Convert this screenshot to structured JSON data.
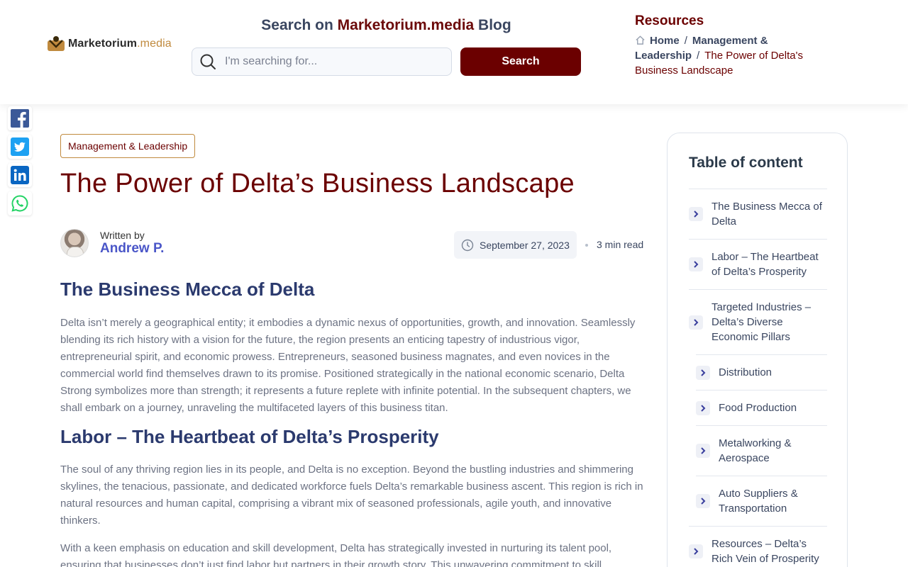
{
  "brand": {
    "name_bold": "Marketorium",
    "name_light": ".media"
  },
  "search": {
    "title_prefix": "Search on ",
    "title_brand": "Marketorium.media",
    "title_suffix": " Blog",
    "placeholder": "I'm searching for...",
    "value": "",
    "button_label": "Search"
  },
  "resources": {
    "title": "Resources",
    "breadcrumb": [
      {
        "label": "Home"
      },
      {
        "label": "Management & Leadership"
      },
      {
        "label": "The Power of Delta's Business Landscape"
      }
    ]
  },
  "social": [
    {
      "name": "facebook-icon",
      "color": "#3b5998"
    },
    {
      "name": "twitter-icon",
      "color": "#1da1f2"
    },
    {
      "name": "linkedin-icon",
      "color": "#0a66c2"
    },
    {
      "name": "whatsapp-icon",
      "color": "#25d366"
    }
  ],
  "article": {
    "category": "Management & Leadership",
    "title": "The Power of Delta’s Business Landscape",
    "author_label": "Written by",
    "author_name": "Andrew P.",
    "date": "September 27, 2023",
    "read_time": "3 min read",
    "sections": [
      {
        "heading": "The Business Mecca of Delta",
        "paragraphs": [
          "Delta isn’t merely a geographical entity; it embodies a dynamic nexus of opportunities, growth, and innovation. Seamlessly blending its rich history with a vision for the future, the region presents an enticing tapestry of industrious vigor, entrepreneurial spirit, and economic prowess. Entrepreneurs, seasoned business magnates, and even novices in the commercial world find themselves drawn to its promise. Positioned strategically in the national economic scenario, Delta Strong symbolizes more than strength; it represents a future replete with infinite potential. In the subsequent chapters, we shall embark on a journey, unraveling the multifaceted layers of this business titan."
        ]
      },
      {
        "heading": "Labor – The Heartbeat of Delta’s Prosperity",
        "paragraphs": [
          "The soul of any thriving region lies in its people, and Delta is no exception. Beyond the bustling industries and shimmering skylines, the tenacious, passionate, and dedicated workforce fuels Delta’s remarkable business ascent. This region is rich in natural resources and human capital, comprising a vibrant mix of seasoned professionals, agile youth, and innovative thinkers.",
          "With a keen emphasis on education and skill development, Delta has strategically invested in nurturing its talent pool, ensuring that businesses don’t just find labor but partners in their growth story. This unwavering commitment to skill"
        ]
      }
    ]
  },
  "toc": {
    "title": "Table of content",
    "items": [
      {
        "label": "The Business Mecca of Delta",
        "sub": false
      },
      {
        "label": "Labor – The Heartbeat of Delta’s Prosperity",
        "sub": false
      },
      {
        "label": "Targeted Industries – Delta’s Diverse Economic Pillars",
        "sub": false
      },
      {
        "label": "Distribution",
        "sub": true
      },
      {
        "label": "Food Production",
        "sub": true
      },
      {
        "label": "Metalworking & Aerospace",
        "sub": true
      },
      {
        "label": "Auto Suppliers & Transportation",
        "sub": true
      },
      {
        "label": "Resources – Delta’s Rich Vein of Prosperity",
        "sub": false
      }
    ]
  },
  "colors": {
    "brand_dark_red": "#6b0000",
    "heading_navy": "#2b3a6e",
    "author_blue": "#4a56c8",
    "accent_gold": "#c08a3e"
  }
}
